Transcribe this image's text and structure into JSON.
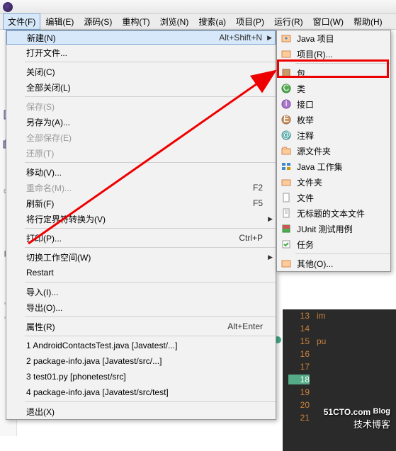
{
  "menubar": {
    "items": [
      {
        "label": "文件(F)"
      },
      {
        "label": "编辑(E)"
      },
      {
        "label": "源码(S)"
      },
      {
        "label": "重构(T)"
      },
      {
        "label": "浏览(N)"
      },
      {
        "label": "搜索(a)"
      },
      {
        "label": "项目(P)"
      },
      {
        "label": "运行(R)"
      },
      {
        "label": "窗口(W)"
      },
      {
        "label": "帮助(H)"
      }
    ]
  },
  "filemenu": {
    "new": {
      "label": "新建(N)",
      "shortcut": "Alt+Shift+N"
    },
    "open": {
      "label": "打开文件..."
    },
    "close": {
      "label": "关闭(C)"
    },
    "closeall": {
      "label": "全部关闭(L)"
    },
    "save": {
      "label": "保存(S)"
    },
    "saveas": {
      "label": "另存为(A)..."
    },
    "saveall": {
      "label": "全部保存(E)"
    },
    "revert": {
      "label": "还原(T)"
    },
    "move": {
      "label": "移动(V)..."
    },
    "rename": {
      "label": "重命名(M)...",
      "shortcut": "F2"
    },
    "refresh": {
      "label": "刷新(F)",
      "shortcut": "F5"
    },
    "convert": {
      "label": "将行定界符转换为(V)"
    },
    "print": {
      "label": "打印(P)...",
      "shortcut": "Ctrl+P"
    },
    "switchws": {
      "label": "切换工作空间(W)"
    },
    "restart": {
      "label": "Restart"
    },
    "import": {
      "label": "导入(I)..."
    },
    "export": {
      "label": "导出(O)..."
    },
    "properties": {
      "label": "属性(R)",
      "shortcut": "Alt+Enter"
    },
    "recent1": {
      "label": "1 AndroidContactsTest.java  [Javatest/...]"
    },
    "recent2": {
      "label": "2 package-info.java  [Javatest/src/...]"
    },
    "recent3": {
      "label": "3 test01.py  [phonetest/src]"
    },
    "recent4": {
      "label": "4 package-info.java  [Javatest/src/test]"
    },
    "exit": {
      "label": "退出(X)"
    }
  },
  "submenu": {
    "javaproject": {
      "label": "Java 项目"
    },
    "project": {
      "label": "项目(R)..."
    },
    "package": {
      "label": "包"
    },
    "class": {
      "label": "类"
    },
    "interface": {
      "label": "接口"
    },
    "enum": {
      "label": "枚举"
    },
    "annotation": {
      "label": "注释"
    },
    "srcfolder": {
      "label": "源文件夹"
    },
    "workingset": {
      "label": "Java 工作集"
    },
    "folder": {
      "label": "文件夹"
    },
    "file": {
      "label": "文件"
    },
    "untitled": {
      "label": "无标题的文本文件"
    },
    "junit": {
      "label": "JUnit 测试用例"
    },
    "task": {
      "label": "任务"
    },
    "other": {
      "label": "其他(O)..."
    }
  },
  "editor": {
    "lines": [
      {
        "num": "13",
        "text": "im"
      },
      {
        "num": "14",
        "text": ""
      },
      {
        "num": "15",
        "text": "pu"
      },
      {
        "num": "16",
        "text": ""
      },
      {
        "num": "17",
        "text": ""
      },
      {
        "num": "18",
        "text": ""
      },
      {
        "num": "19",
        "text": ""
      },
      {
        "num": "20",
        "text": ""
      },
      {
        "num": "21",
        "text": ""
      }
    ]
  },
  "watermark": {
    "main": "51CTO.com",
    "sub": "技术博客",
    "blog": "Blog"
  }
}
